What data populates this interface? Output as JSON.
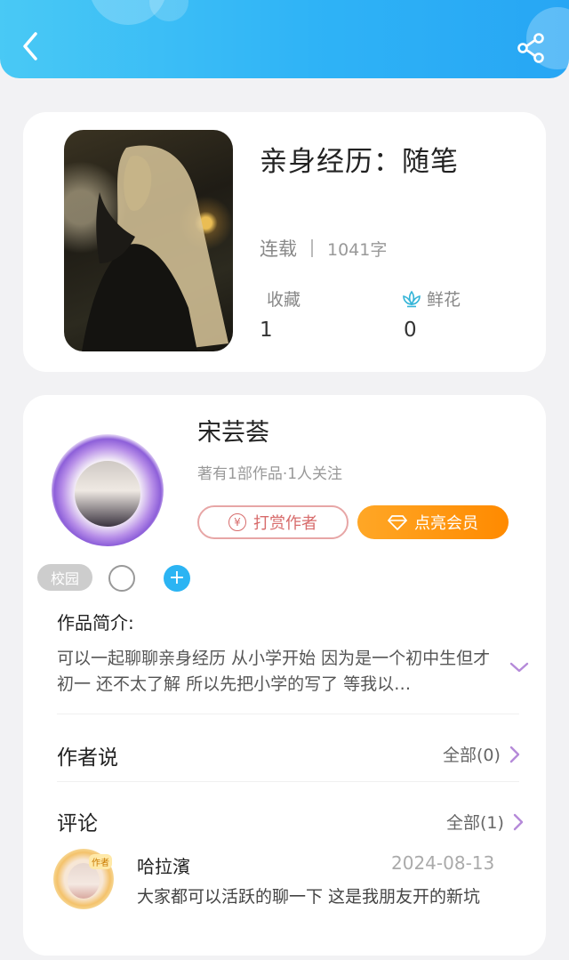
{
  "header": {
    "back_icon": "chevron-left-icon",
    "share_icon": "share-icon",
    "accent_color": "#2fb3f6"
  },
  "book": {
    "title": "亲身经历：随笔",
    "status": "连载",
    "word_count": "1041字",
    "favorites_label": "收藏",
    "favorites_value": "1",
    "flowers_label": "鲜花",
    "flowers_value": "0",
    "flower_icon": "lotus-icon"
  },
  "author": {
    "name": "宋芸荟",
    "meta": "著有1部作品·1人关注",
    "tip_label": "打赏作者",
    "vip_label": "点亮会员",
    "tag": "校园",
    "add_symbol": "+"
  },
  "intro": {
    "title": "作品简介:",
    "text": "可以一起聊聊亲身经历 从小学开始 因为是一个初中生但才初一 还不太了解 所以先把小学的写了 等我以…"
  },
  "author_says": {
    "title": "作者说",
    "link": "全部(0)"
  },
  "comments": {
    "title": "评论",
    "link": "全部(1)",
    "items": [
      {
        "badge": "作者",
        "name": "哈拉濱",
        "date": "2024-08-13",
        "text": "大家都可以活跃的聊一下 这是我朋友开的新坑"
      }
    ]
  }
}
